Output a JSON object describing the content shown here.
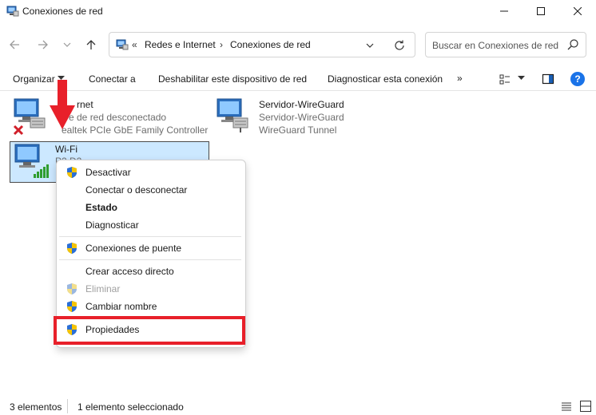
{
  "window": {
    "title": "Conexiones de red",
    "icon": "network-folder-icon",
    "controls": [
      "minimize-icon",
      "maximize-icon",
      "close-icon"
    ]
  },
  "address": {
    "overflow": "«",
    "crumbs": [
      "Redes e Internet",
      "Conexiones de red"
    ],
    "separator": "›"
  },
  "search": {
    "placeholder": "Buscar en Conexiones de red"
  },
  "commandbar": {
    "organize": "Organizar",
    "connect_to": "Conectar a",
    "disable": "Deshabilitar este dispositivo de red",
    "diagnose": "Diagnosticar esta conexión",
    "more": "»"
  },
  "items": [
    {
      "name": "Ethernet",
      "name_visible": "rnet",
      "status": "Cable de red desconectado",
      "status_visible": "e de red desconectado",
      "adapter": "Realtek PCIe GbE Family Controller",
      "adapter_visible": "ealtek PCIe GbE Family Controller",
      "state_icon": "disconnected-x-icon"
    },
    {
      "name": "Servidor-WireGuard",
      "status": "Servidor-WireGuard",
      "adapter": "WireGuard Tunnel",
      "state_icon": "cable-icon"
    },
    {
      "name": "Wi-Fi",
      "status_visible": "P2 D2",
      "state_icon": "signal-bars-icon",
      "selected": true
    }
  ],
  "context_menu": {
    "items": [
      {
        "label": "Desactivar",
        "shield": true,
        "bold": false,
        "disabled": false
      },
      {
        "label": "Conectar o desconectar",
        "shield": false,
        "bold": false,
        "disabled": false
      },
      {
        "label": "Estado",
        "shield": false,
        "bold": true,
        "disabled": false
      },
      {
        "label": "Diagnosticar",
        "shield": false,
        "bold": false,
        "disabled": false
      },
      {
        "label": "Conexiones de puente",
        "shield": true,
        "bold": false,
        "disabled": false
      },
      {
        "label": "Crear acceso directo",
        "shield": false,
        "bold": false,
        "disabled": false
      },
      {
        "label": "Eliminar",
        "shield": true,
        "bold": false,
        "disabled": true
      },
      {
        "label": "Cambiar nombre",
        "shield": true,
        "bold": false,
        "disabled": false
      },
      {
        "label": "Propiedades",
        "shield": true,
        "bold": false,
        "disabled": false,
        "highlighted": true
      }
    ]
  },
  "statusbar": {
    "count": "3 elementos",
    "selection": "1 elemento seleccionado"
  },
  "colors": {
    "selection_bg": "#cce8ff",
    "highlight_border": "#e8202a",
    "arrow": "#e8202a",
    "help": "#1a73e8"
  }
}
